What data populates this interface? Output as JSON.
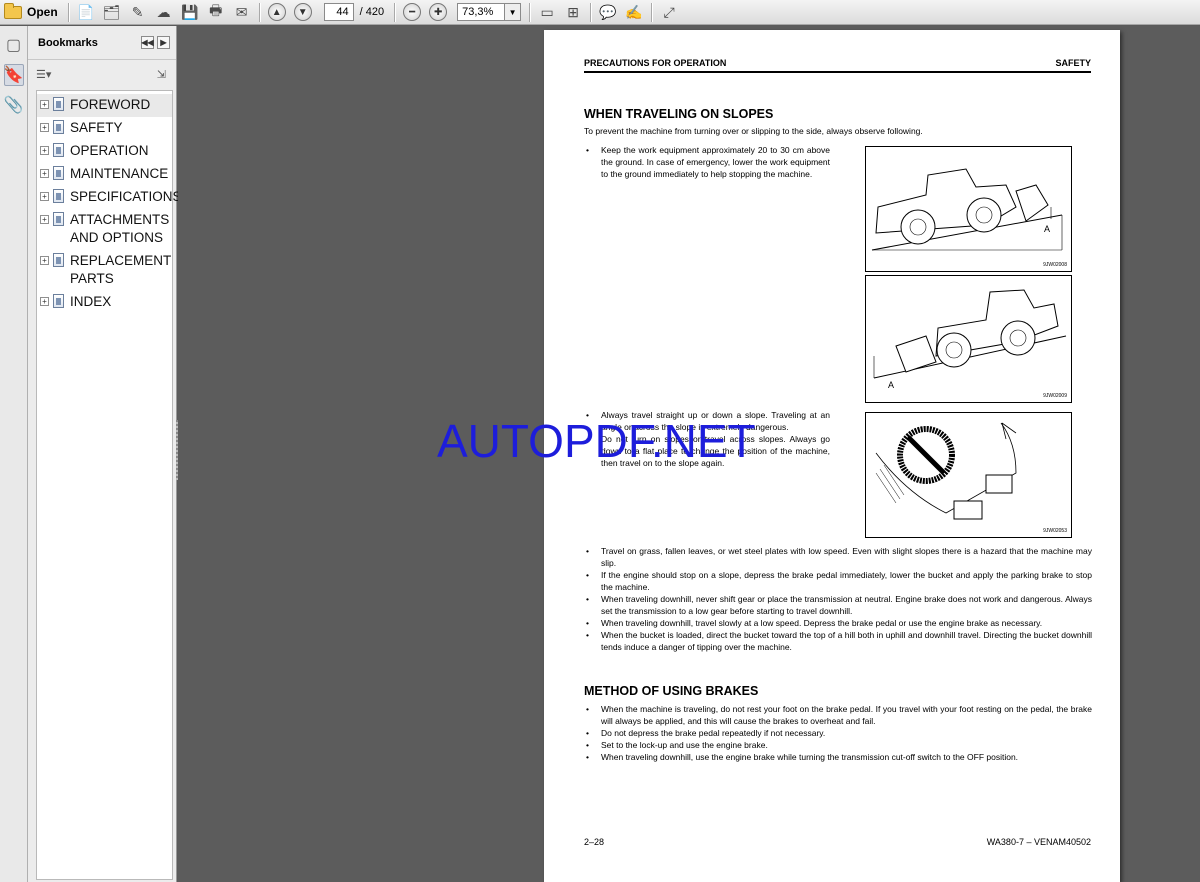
{
  "toolbar": {
    "open_label": "Open",
    "page_current": "44",
    "page_total": "/ 420",
    "zoom": "73,3%"
  },
  "bookmarks": {
    "title": "Bookmarks",
    "items": [
      {
        "label": "FOREWORD"
      },
      {
        "label": "SAFETY"
      },
      {
        "label": "OPERATION"
      },
      {
        "label": "MAINTENANCE"
      },
      {
        "label": "SPECIFICATIONS"
      },
      {
        "label": "ATTACHMENTS AND OPTIONS"
      },
      {
        "label": "REPLACEMENT PARTS"
      },
      {
        "label": "INDEX"
      }
    ]
  },
  "page": {
    "header_left": "PRECAUTIONS FOR OPERATION",
    "header_right": "SAFETY",
    "section1_title": "WHEN TRAVELING ON SLOPES",
    "section1_intro": "To prevent the machine from turning over or slipping to the side, always observe following.",
    "bullet_equipment": "Keep the work equipment approximately 20 to 30 cm above the ground. In case of emergency, lower the work equipment to the ground immediately to help stopping the machine.",
    "bullet_straight": "Always travel straight up or down a slope. Traveling at an angle or across the slope is extremely dangerous.",
    "bullet_turn": "Do not turn on slopes or travel across slopes. Always go down to a flat place to change the position of the machine, then travel on to the slope again.",
    "fig1_code": "9JW02008",
    "fig2_code": "9JW02009",
    "fig3_code": "9JW02053",
    "fig_label_a": "A",
    "full_bullets": [
      "Travel on grass, fallen leaves, or wet steel plates with low speed. Even with slight slopes there is a hazard that the machine may slip.",
      "If the engine should stop on a slope, depress the brake pedal immediately, lower the bucket and apply the parking brake to stop the machine.",
      "When traveling downhill, never shift gear or place the transmission at neutral. Engine brake does not work and dangerous. Always set the transmission to a low gear before starting to travel downhill.",
      "When traveling downhill, travel slowly at a low speed. Depress the brake pedal or use the engine brake as necessary.",
      "When the bucket is loaded, direct the bucket toward the top of a hill both in uphill and downhill travel. Directing the bucket downhill tends induce a danger of tipping over the machine."
    ],
    "section2_title": "METHOD OF USING BRAKES",
    "brake_bullets": [
      "When the machine is traveling, do not rest your foot on the brake pedal. If you travel with your foot resting on the pedal, the brake will always be applied, and this will cause the brakes to overheat and fail.",
      "Do not depress the brake pedal repeatedly if not necessary.",
      "Set to the lock-up and use the engine brake.",
      "When traveling downhill, use the engine brake while turning the transmission cut-off switch to the OFF position."
    ],
    "footer_left": "2–28",
    "footer_right": "WA380-7 – VENAM40502"
  },
  "watermark": "AUTOPDF.NET"
}
